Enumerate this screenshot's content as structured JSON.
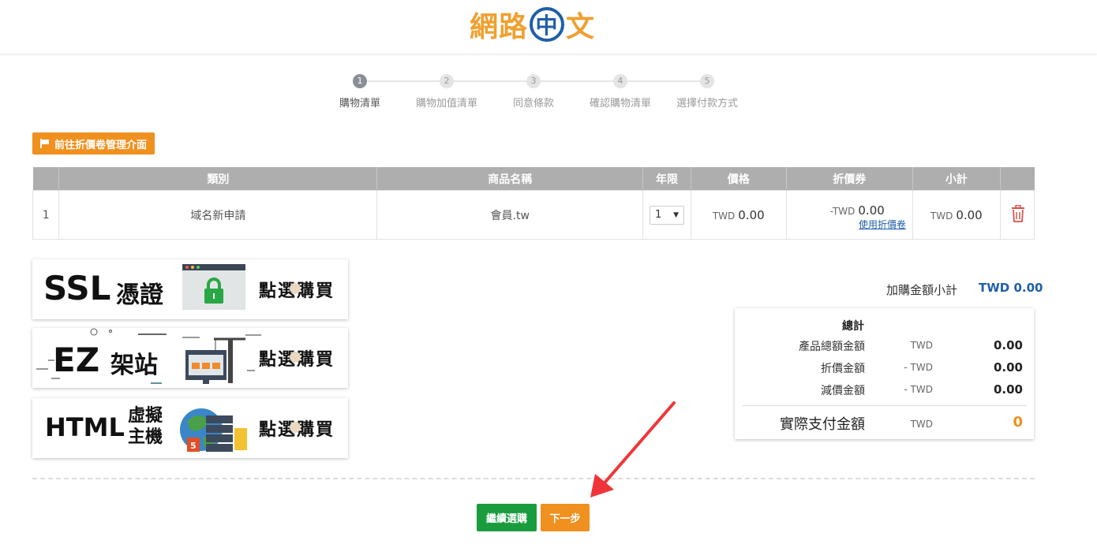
{
  "logo": {
    "part1": "網路",
    "circle": "中",
    "part2": "文"
  },
  "steps": [
    {
      "num": "1",
      "label": "購物清單",
      "active": true
    },
    {
      "num": "2",
      "label": "購物加值清單",
      "active": false
    },
    {
      "num": "3",
      "label": "同意條款",
      "active": false
    },
    {
      "num": "4",
      "label": "確認購物清單",
      "active": false
    },
    {
      "num": "5",
      "label": "選擇付款方式",
      "active": false
    }
  ],
  "coupon_button": "前往折價卷管理介面",
  "table": {
    "headers": [
      "",
      "類別",
      "商品名稱",
      "年限",
      "價格",
      "折價券",
      "小計",
      ""
    ],
    "row": {
      "index": "1",
      "category": "域名新申請",
      "product": "會員.tw",
      "years": "1",
      "price_currency": "TWD",
      "price": "0.00",
      "discount_currency": "-TWD",
      "discount": "0.00",
      "use_coupon": "使用折價卷",
      "subtotal_currency": "TWD",
      "subtotal": "0.00"
    }
  },
  "banners": [
    {
      "title": "SSL",
      "subtitle": "憑證",
      "buy": "點選購買"
    },
    {
      "title": "EZ",
      "subtitle": "架站",
      "buy": "點選購買"
    },
    {
      "title": "HTML",
      "subtitle": "虛擬主機",
      "subtitle_line1": "虛擬",
      "subtitle_line2": "主機",
      "buy": "點選購買"
    }
  ],
  "addon_subtotal": {
    "label": "加購金額小計",
    "value": "TWD 0.00"
  },
  "summary": {
    "title": "總計",
    "rows": [
      {
        "label": "產品總額金額",
        "currency": "TWD",
        "value": "0.00"
      },
      {
        "label": "折價金額",
        "currency": "- TWD",
        "value": "0.00"
      },
      {
        "label": "減價金額",
        "currency": "- TWD",
        "value": "0.00"
      }
    ],
    "total": {
      "label": "實際支付金額",
      "currency": "TWD",
      "value": "0"
    }
  },
  "buttons": {
    "continue": "繼續選購",
    "next": "下一步"
  },
  "colors": {
    "orange": "#f0901e",
    "green": "#1a9c3e",
    "blue": "#1f5fa8",
    "red_arrow": "#f0353a"
  }
}
